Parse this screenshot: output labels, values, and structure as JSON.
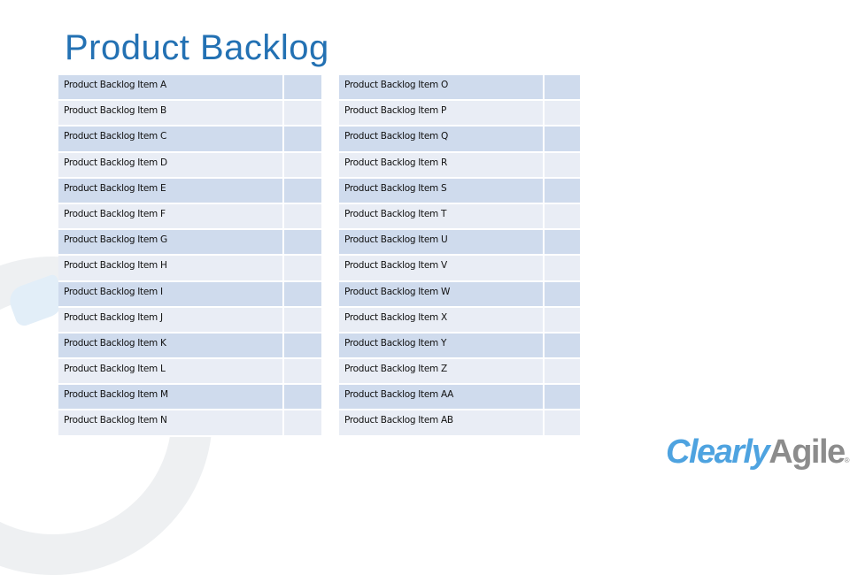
{
  "title": "Product Backlog",
  "left_table": [
    {
      "item": "Product Backlog Item A",
      "value": ""
    },
    {
      "item": "Product Backlog Item B",
      "value": ""
    },
    {
      "item": "Product Backlog Item C",
      "value": ""
    },
    {
      "item": "Product Backlog Item D",
      "value": ""
    },
    {
      "item": "Product Backlog Item E",
      "value": ""
    },
    {
      "item": "Product Backlog Item F",
      "value": ""
    },
    {
      "item": "Product Backlog Item G",
      "value": ""
    },
    {
      "item": "Product Backlog Item H",
      "value": ""
    },
    {
      "item": "Product Backlog Item I",
      "value": ""
    },
    {
      "item": "Product Backlog Item J",
      "value": ""
    },
    {
      "item": "Product Backlog Item K",
      "value": ""
    },
    {
      "item": "Product Backlog Item L",
      "value": ""
    },
    {
      "item": "Product Backlog Item M",
      "value": ""
    },
    {
      "item": "Product Backlog Item N",
      "value": ""
    }
  ],
  "right_table": [
    {
      "item": "Product Backlog Item O",
      "value": ""
    },
    {
      "item": "Product Backlog Item P",
      "value": ""
    },
    {
      "item": "Product Backlog Item Q",
      "value": ""
    },
    {
      "item": "Product Backlog Item R",
      "value": ""
    },
    {
      "item": "Product Backlog Item S",
      "value": ""
    },
    {
      "item": "Product Backlog Item T",
      "value": ""
    },
    {
      "item": "Product Backlog Item U",
      "value": ""
    },
    {
      "item": "Product Backlog Item V",
      "value": ""
    },
    {
      "item": "Product Backlog Item W",
      "value": ""
    },
    {
      "item": "Product Backlog Item X",
      "value": ""
    },
    {
      "item": "Product Backlog Item Y",
      "value": ""
    },
    {
      "item": "Product Backlog Item Z",
      "value": ""
    },
    {
      "item": "Product Backlog Item AA",
      "value": ""
    },
    {
      "item": "Product Backlog Item AB",
      "value": ""
    }
  ],
  "logo": {
    "part1": "Clearly",
    "part2": "Agile",
    "mark": "®"
  },
  "colors": {
    "title": "#2371b3",
    "row_dark": "#cfdbed",
    "row_light": "#e9edf5",
    "logo_blue": "#4ea3e0",
    "logo_gray": "#8c8c8c"
  }
}
